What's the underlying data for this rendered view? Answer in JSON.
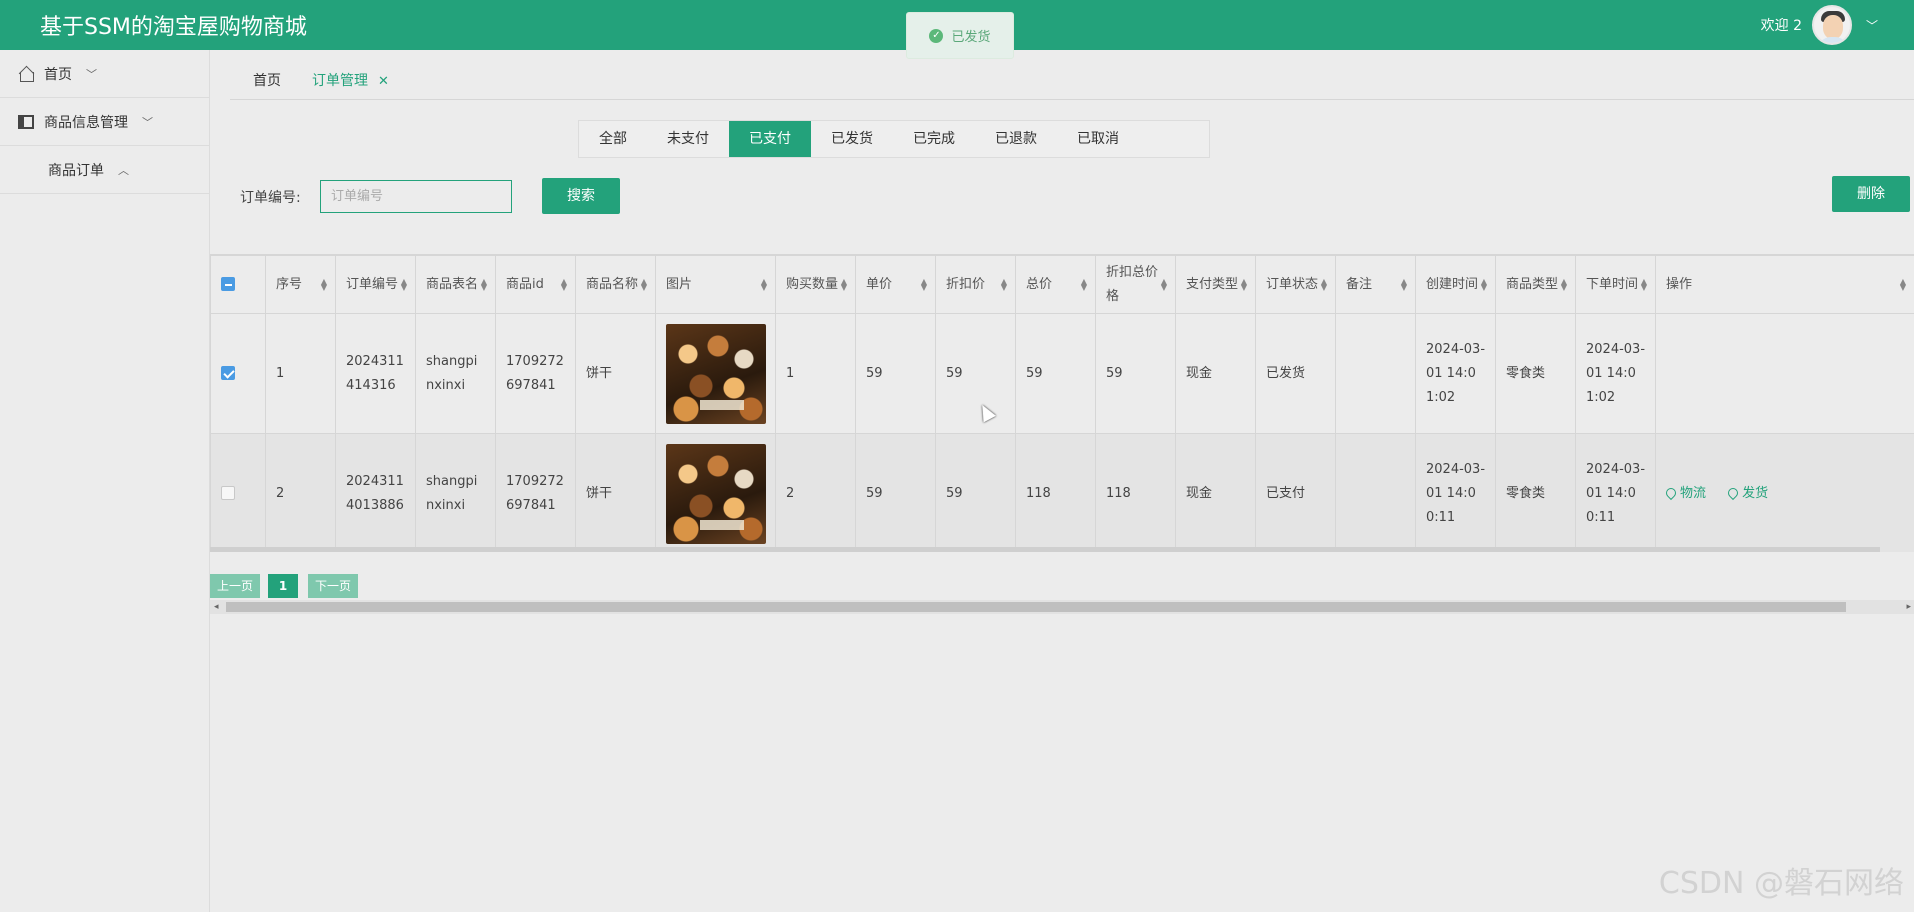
{
  "header": {
    "title": "基于SSM的淘宝屋购物商城",
    "welcome": "欢迎 2"
  },
  "toast": {
    "text": "已发货"
  },
  "sidebar": {
    "items": [
      {
        "label": "首页",
        "icon": "home-icon"
      },
      {
        "label": "商品信息管理",
        "icon": "box-icon"
      },
      {
        "label": "商品订单"
      }
    ]
  },
  "tabs": [
    {
      "label": "首页"
    },
    {
      "label": "订单管理",
      "active": true
    }
  ],
  "status_tabs": [
    "全部",
    "未支付",
    "已支付",
    "已发货",
    "已完成",
    "已退款",
    "已取消"
  ],
  "active_status": "已支付",
  "search": {
    "label": "订单编号:",
    "placeholder": "订单编号",
    "button": "搜索"
  },
  "delete_button": "删除",
  "table": {
    "columns": [
      "序号",
      "订单编号",
      "商品表名",
      "商品id",
      "商品名称",
      "图片",
      "购买数量",
      "单价",
      "折扣价",
      "总价",
      "折扣总价格",
      "支付类型",
      "订单状态",
      "备注",
      "创建时间",
      "商品类型",
      "下单时间",
      "操作"
    ],
    "rows": [
      {
        "checked": true,
        "index": "1",
        "order_no": "2024311414316",
        "table_name": "shangpinxinxi",
        "product_id": "1709272697841",
        "product_name": "饼干",
        "quantity": "1",
        "price": "59",
        "discount_price": "59",
        "total": "59",
        "discount_total": "59",
        "pay_type": "现金",
        "status": "已发货",
        "remark": "",
        "created": "2024-03-01 14:01:02",
        "category": "零食类",
        "order_time": "2024-03-01 14:01:02",
        "actions": []
      },
      {
        "checked": false,
        "index": "2",
        "order_no": "20243114013886",
        "table_name": "shangpinxinxi",
        "product_id": "1709272697841",
        "product_name": "饼干",
        "quantity": "2",
        "price": "59",
        "discount_price": "59",
        "total": "118",
        "discount_total": "118",
        "pay_type": "现金",
        "status": "已支付",
        "remark": "",
        "created": "2024-03-01 14:00:11",
        "category": "零食类",
        "order_time": "2024-03-01 14:00:11",
        "actions": [
          "物流",
          "发货"
        ]
      }
    ]
  },
  "pager": {
    "prev": "上一页",
    "page": "1",
    "next": "下一页"
  },
  "watermark": "CSDN @磐石网络",
  "colors": {
    "primary": "#23a27b",
    "header": "#23a27b",
    "checkbox": "#4a9be3"
  }
}
